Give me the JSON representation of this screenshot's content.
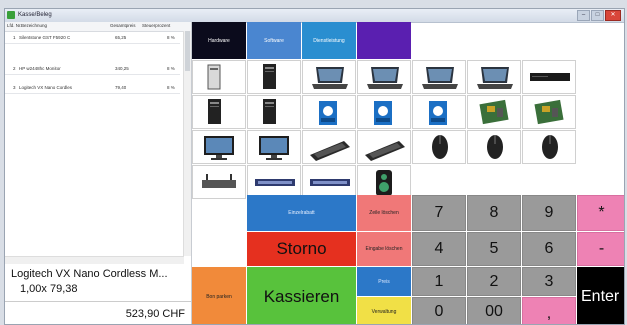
{
  "window": {
    "title": "Kasse/Beleg"
  },
  "list": {
    "headers": [
      "Lfd. Nr.",
      "Bezeichnung",
      "Gesamtpreis",
      "Steuerprozent"
    ],
    "rows": [
      {
        "nr": "1",
        "name": "Silentstone GST F5920 C",
        "price": "65,25",
        "tax": "8 %"
      },
      {
        "nr": "2",
        "name": "HP w2448hc Monitor",
        "price": "340,25",
        "tax": "8 %"
      },
      {
        "nr": "3",
        "name": "Logitech VX Nano Cordles",
        "price": "79,40",
        "tax": "8 %"
      }
    ]
  },
  "detail": {
    "name": "Logitech VX Nano Cordless M...",
    "qty": "1,00x  79,38",
    "total": "523,90 CHF"
  },
  "categories": [
    {
      "label": "Hardware",
      "color": "#0b0b1c"
    },
    {
      "label": "Software",
      "color": "#4a86d0"
    },
    {
      "label": "Dienstleistung",
      "color": "#2a8ed0"
    },
    {
      "label": "",
      "color": "#5a1fb0"
    }
  ],
  "products": [
    "desktop-tower-icon",
    "pc-tower-icon",
    "laptop-icon",
    "laptop-icon",
    "laptop-icon",
    "laptop-icon",
    "dvd-drive-icon",
    "pc-tower-icon",
    "pc-tower-icon",
    "cpu-box-icon",
    "cpu-box-icon",
    "cpu-box-icon",
    "motherboard-icon",
    "motherboard-icon",
    "monitor-icon",
    "monitor-icon",
    "keyboard-icon",
    "keyboard-icon",
    "mouse-icon",
    "mouse-icon",
    "mouse-icon",
    "router-icon",
    "switch-icon",
    "switch-icon",
    "speaker-icon"
  ],
  "actions": {
    "einzelrabatt": "Einzelrabatt",
    "zeile_loschen": "Zeile löschen",
    "eingabe_loschen": "Eingabe löschen",
    "storno": "Storno",
    "kassieren": "Kassieren",
    "bon_parken": "Bon parken",
    "preis": "Preis",
    "verwaltung": "Verwaltung",
    "enter": "Enter"
  },
  "keypad": {
    "digits": [
      "7",
      "8",
      "9",
      "4",
      "5",
      "6",
      "1",
      "2",
      "3"
    ],
    "zero": "0",
    "double_zero": "00",
    "comma": ",",
    "multiply": "*",
    "minus": "-"
  },
  "colors": {
    "storno": "#e5301f",
    "kassieren": "#58c23c",
    "bon_parken": "#f18a3a",
    "blue_btn": "#2c78c8",
    "salmon": "#f07878",
    "yellow": "#f1e046",
    "enter": "#000000"
  }
}
